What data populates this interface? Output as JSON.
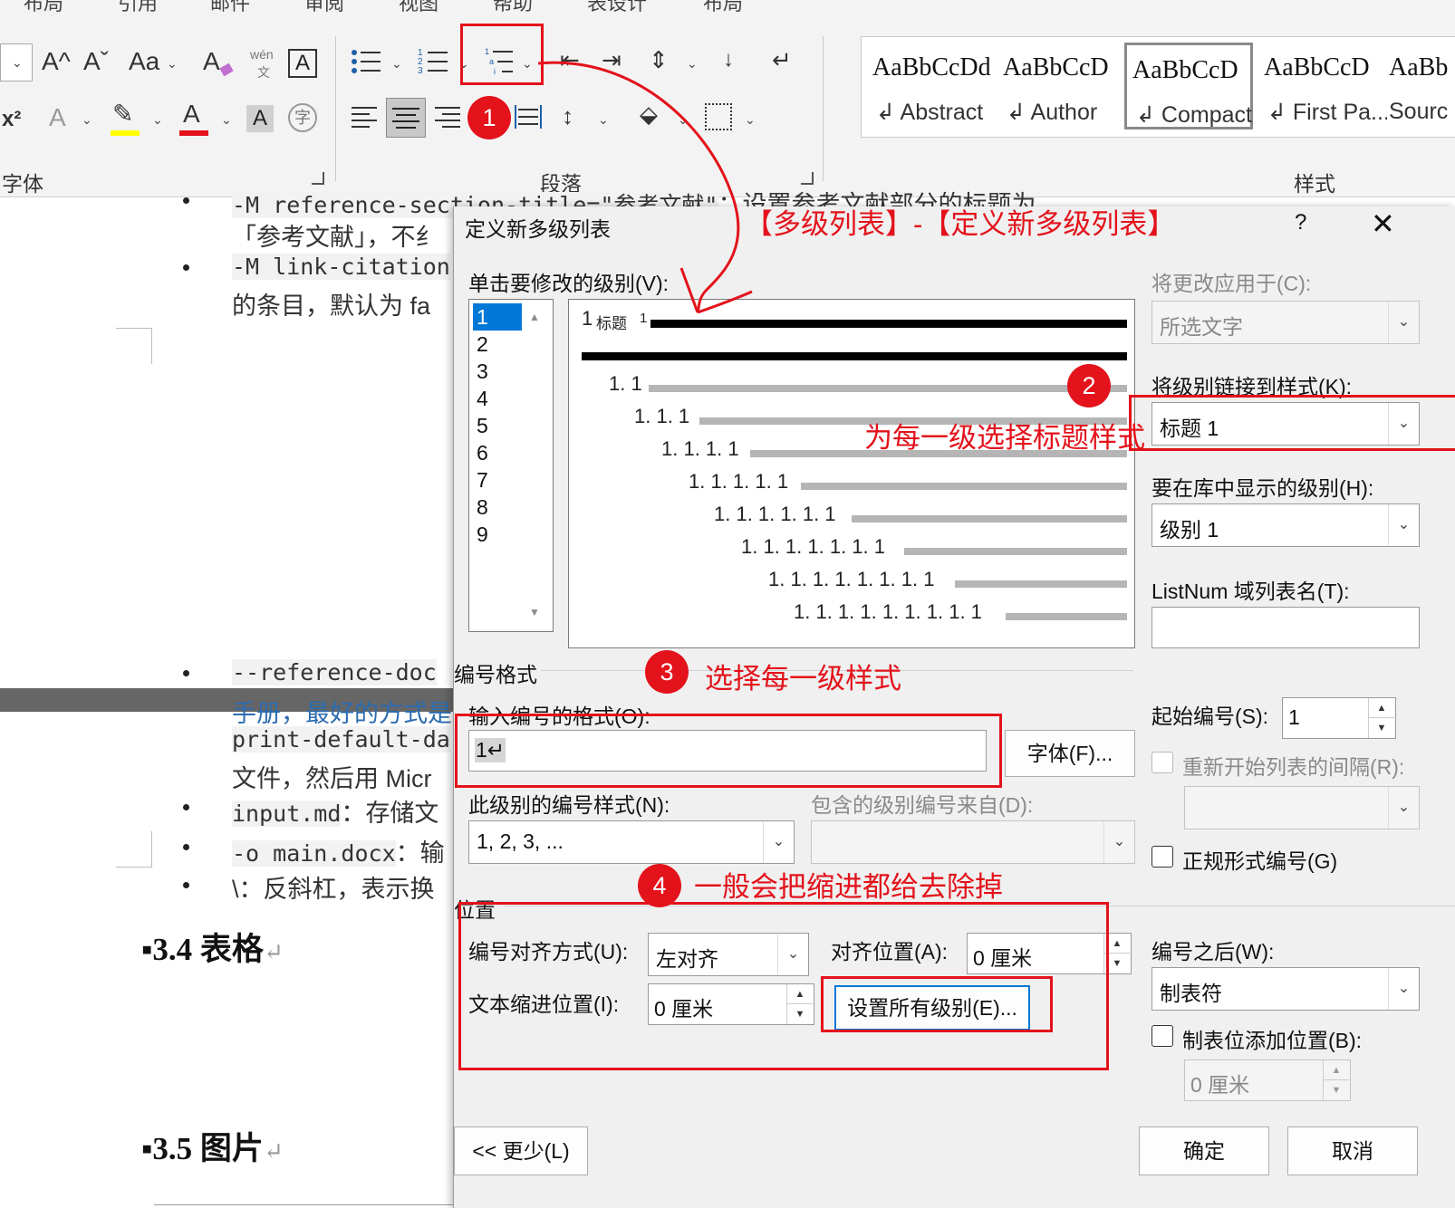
{
  "ribbon": {
    "tabs": [
      "布局",
      "引用",
      "邮件",
      "审阅",
      "视图",
      "帮助",
      "表设计",
      "布局"
    ],
    "groups": {
      "font": "字体",
      "paragraph": "段落",
      "styles": "样式"
    },
    "font_icons": {
      "grow": "A^",
      "shrink": "Aˇ",
      "change_case": "Aa",
      "clear": "A",
      "phonetic_top": "wén",
      "phonetic_bottom": "文",
      "char_border": "A",
      "superscript": "x²",
      "text_effect": "A",
      "highlight": "✎",
      "font_color": "A",
      "char_shading": "A",
      "enclose": "字"
    },
    "styles": [
      {
        "sample": "AaBbCcDd",
        "name": "Abstract"
      },
      {
        "sample": "AaBbCcD",
        "name": "Author"
      },
      {
        "sample": "AaBbCcD",
        "name": "Compact"
      },
      {
        "sample": "AaBbCcD",
        "name": "First Pa..."
      },
      {
        "sample": "AaBb",
        "name": "Sourc"
      }
    ],
    "colors": {
      "highlight": "#ffff00",
      "font_color": "#e3121b"
    }
  },
  "document": {
    "lines": [
      {
        "code": "-M reference-section-title=\"参考文献\"",
        "text": "：设置参考文献部分的标题为"
      },
      {
        "code": "",
        "text": "「参考文献」，不纟"
      },
      {
        "code": "-M link-citation",
        "text": ""
      },
      {
        "code": "",
        "text": "的条目，默认为 fa"
      },
      {
        "code": "--reference-doc",
        "text": ""
      },
      {
        "code": "",
        "text": "手册，最好的方式是"
      },
      {
        "code": "print-default-da",
        "text": ""
      },
      {
        "code": "",
        "text": "文件，然后用 Micr"
      },
      {
        "code": "input.md",
        "text": "：存储文"
      },
      {
        "code": "-o main.docx",
        "text": "：输"
      },
      {
        "code": "",
        "text": "\\：反斜杠，表示换"
      }
    ],
    "headings": [
      "3.4 表格",
      "3.5 图片"
    ]
  },
  "dialog": {
    "title": "定义新多级列表",
    "help": "?",
    "close": "✕",
    "click_level_label": "单击要修改的级别(V):",
    "levels": [
      "1",
      "2",
      "3",
      "4",
      "5",
      "6",
      "7",
      "8",
      "9"
    ],
    "selected_level": "1",
    "preview": {
      "first_num": "1",
      "first_label": "标题",
      "first_suffix": "1",
      "nums": [
        "1. 1",
        "1. 1. 1",
        "1. 1. 1. 1",
        "1. 1. 1. 1. 1",
        "1. 1. 1. 1. 1. 1",
        "1. 1. 1. 1. 1. 1. 1",
        "1. 1. 1. 1. 1. 1. 1. 1",
        "1. 1. 1. 1. 1. 1. 1. 1. 1"
      ]
    },
    "apply_to_label": "将更改应用于(C):",
    "apply_to_value": "所选文字",
    "link_style_label": "将级别链接到样式(K):",
    "link_style_value": "标题 1",
    "gallery_level_label": "要在库中显示的级别(H):",
    "gallery_level_value": "级别 1",
    "listnum_label": "ListNum 域列表名(T):",
    "listnum_value": "",
    "number_format_section": "编号格式",
    "enter_format_label": "输入编号的格式(O):",
    "enter_format_value": "1↵",
    "font_button": "字体(F)...",
    "number_style_label": "此级别的编号样式(N):",
    "number_style_value": "1, 2, 3, ...",
    "include_level_label": "包含的级别编号来自(D):",
    "include_level_value": "",
    "start_at_label": "起始编号(S):",
    "start_at_value": "1",
    "restart_label": "重新开始列表的间隔(R):",
    "restart_value": "",
    "legal_label": "正规形式编号(G)",
    "position_section": "位置",
    "align_label": "编号对齐方式(U):",
    "align_value": "左对齐",
    "aligned_at_label": "对齐位置(A):",
    "aligned_at_value": "0 厘米",
    "indent_label": "文本缩进位置(I):",
    "indent_value": "0 厘米",
    "set_all_button": "设置所有级别(E)...",
    "follow_label": "编号之后(W):",
    "follow_value": "制表符",
    "tab_stop_label": "制表位添加位置(B):",
    "tab_stop_value": "0 厘米",
    "less_button": "<< 更少(L)",
    "ok_button": "确定",
    "cancel_button": "取消"
  },
  "annotations": {
    "header": "【多级列表】-【定义新多级列表】",
    "step1": "1",
    "step2": "2",
    "step2_text": "为每一级选择标题样式",
    "step3": "3",
    "step3_text": "选择每一级样式",
    "step4": "4",
    "step4_text": "一般会把缩进都给去除掉",
    "color": "#e3121b"
  }
}
